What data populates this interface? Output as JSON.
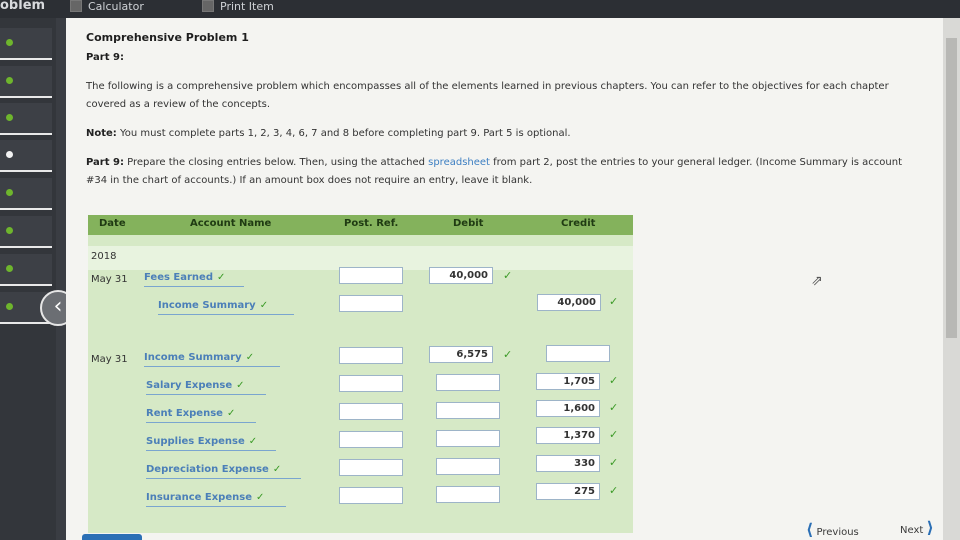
{
  "topbar": {
    "problem_label": "oblem",
    "calculator": "Calculator",
    "print_item": "Print Item"
  },
  "header": {
    "title": "Comprehensive Problem 1",
    "part": "Part 9:"
  },
  "intro": "The following is a comprehensive problem which encompasses all of the elements learned in previous chapters. You can refer to the objectives for each chapter covered as a review of the concepts.",
  "note": {
    "label": "Note:",
    "text": " You must complete parts 1, 2, 3, 4, 6, 7 and 8 before completing part 9. Part 5 is optional."
  },
  "instruction": {
    "label": "Part 9:",
    "text1": " Prepare the closing entries below. Then, using the attached ",
    "link": "spreadsheet",
    "text2": " from part 2, post the entries to your general ledger. (Income Summary is account #34 in the chart of accounts.) If an amount box does not require an entry, leave it blank."
  },
  "journal": {
    "headers": {
      "date": "Date",
      "account": "Account Name",
      "post_ref": "Post. Ref.",
      "debit": "Debit",
      "credit": "Credit"
    },
    "year": "2018",
    "entry1": {
      "date": "May 31",
      "rows": [
        {
          "account": "Fees Earned",
          "debit": "40,000",
          "credit": ""
        },
        {
          "account": "Income Summary",
          "debit": "",
          "credit": "40,000"
        }
      ]
    },
    "entry2": {
      "date": "May 31",
      "rows": [
        {
          "account": "Income Summary",
          "debit": "6,575",
          "credit": ""
        },
        {
          "account": "Salary Expense",
          "debit": "",
          "credit": "1,705"
        },
        {
          "account": "Rent Expense",
          "debit": "",
          "credit": "1,600"
        },
        {
          "account": "Supplies Expense",
          "debit": "",
          "credit": "1,370"
        },
        {
          "account": "Depreciation Expense",
          "debit": "",
          "credit": "330"
        },
        {
          "account": "Insurance Expense",
          "debit": "",
          "credit": "275"
        }
      ]
    },
    "check": "✓"
  },
  "nav": {
    "previous": "Previous",
    "next": "Next"
  },
  "icons": {
    "back": "chevron-left-icon",
    "check": "check-icon",
    "cursor": "mouse-cursor-icon"
  },
  "colors": {
    "header_green": "#84b25c",
    "body_green": "#d6e9c6",
    "link_blue": "#4b7fb8",
    "check_green": "#3b9a26"
  }
}
